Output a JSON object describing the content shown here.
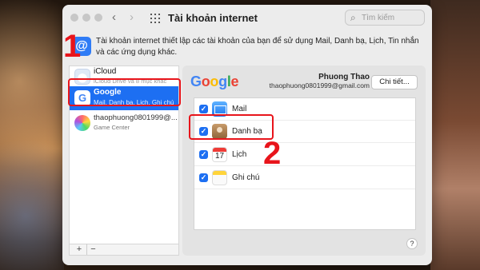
{
  "window": {
    "title": "Tài khoản internet",
    "nav_back": "‹",
    "nav_forward": "›",
    "search_placeholder": "Tìm kiếm"
  },
  "description": "Tài khoản internet thiết lập các tài khoản của bạn để sử dụng Mail, Danh bạ, Lịch, Tin nhắn và các ứng dụng khác.",
  "accounts": [
    {
      "name": "iCloud",
      "sub": "iCloud Drive và 8 mục khác",
      "icon": "icloud-icon"
    },
    {
      "name": "Google",
      "sub": "Mail, Danh bạ, Lịch, Ghi chú",
      "icon": "google-icon",
      "selected": true
    },
    {
      "name": "thaophuong0801999@...",
      "sub": "Game Center",
      "icon": "game-center-icon"
    }
  ],
  "list_controls": {
    "add": "+",
    "remove": "−"
  },
  "detail": {
    "provider_logo": [
      "G",
      "o",
      "o",
      "g",
      "l",
      "e"
    ],
    "user_name": "Phuong Thao",
    "user_email": "thaophuong0801999@gmail.com",
    "details_button": "Chi tiết...",
    "help": "?",
    "services": [
      {
        "label": "Mail",
        "checked": true,
        "icon": "mail-icon"
      },
      {
        "label": "Danh bạ",
        "checked": true,
        "icon": "contacts-icon"
      },
      {
        "label": "Lịch",
        "checked": true,
        "icon": "calendar-icon",
        "icon_text": "17"
      },
      {
        "label": "Ghi chú",
        "checked": true,
        "icon": "notes-icon"
      }
    ]
  },
  "annotations": {
    "step1": "1",
    "step2": "2",
    "color": "#e8141b"
  },
  "colors": {
    "accent": "#1d6ff2",
    "window_bg": "#ececec"
  }
}
